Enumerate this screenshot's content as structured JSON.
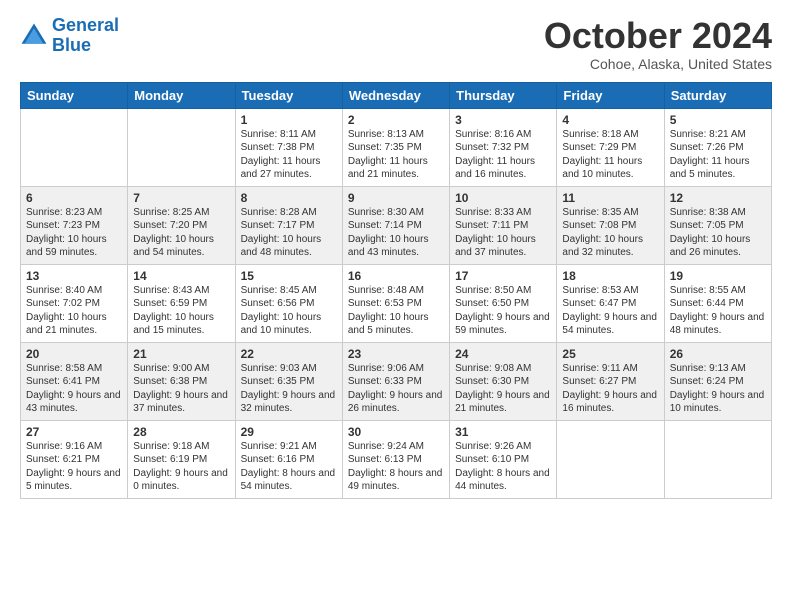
{
  "header": {
    "logo_line1": "General",
    "logo_line2": "Blue",
    "month": "October 2024",
    "location": "Cohoe, Alaska, United States"
  },
  "weekdays": [
    "Sunday",
    "Monday",
    "Tuesday",
    "Wednesday",
    "Thursday",
    "Friday",
    "Saturday"
  ],
  "weeks": [
    [
      {
        "day": "",
        "info": ""
      },
      {
        "day": "",
        "info": ""
      },
      {
        "day": "1",
        "info": "Sunrise: 8:11 AM\nSunset: 7:38 PM\nDaylight: 11 hours and 27 minutes."
      },
      {
        "day": "2",
        "info": "Sunrise: 8:13 AM\nSunset: 7:35 PM\nDaylight: 11 hours and 21 minutes."
      },
      {
        "day": "3",
        "info": "Sunrise: 8:16 AM\nSunset: 7:32 PM\nDaylight: 11 hours and 16 minutes."
      },
      {
        "day": "4",
        "info": "Sunrise: 8:18 AM\nSunset: 7:29 PM\nDaylight: 11 hours and 10 minutes."
      },
      {
        "day": "5",
        "info": "Sunrise: 8:21 AM\nSunset: 7:26 PM\nDaylight: 11 hours and 5 minutes."
      }
    ],
    [
      {
        "day": "6",
        "info": "Sunrise: 8:23 AM\nSunset: 7:23 PM\nDaylight: 10 hours and 59 minutes."
      },
      {
        "day": "7",
        "info": "Sunrise: 8:25 AM\nSunset: 7:20 PM\nDaylight: 10 hours and 54 minutes."
      },
      {
        "day": "8",
        "info": "Sunrise: 8:28 AM\nSunset: 7:17 PM\nDaylight: 10 hours and 48 minutes."
      },
      {
        "day": "9",
        "info": "Sunrise: 8:30 AM\nSunset: 7:14 PM\nDaylight: 10 hours and 43 minutes."
      },
      {
        "day": "10",
        "info": "Sunrise: 8:33 AM\nSunset: 7:11 PM\nDaylight: 10 hours and 37 minutes."
      },
      {
        "day": "11",
        "info": "Sunrise: 8:35 AM\nSunset: 7:08 PM\nDaylight: 10 hours and 32 minutes."
      },
      {
        "day": "12",
        "info": "Sunrise: 8:38 AM\nSunset: 7:05 PM\nDaylight: 10 hours and 26 minutes."
      }
    ],
    [
      {
        "day": "13",
        "info": "Sunrise: 8:40 AM\nSunset: 7:02 PM\nDaylight: 10 hours and 21 minutes."
      },
      {
        "day": "14",
        "info": "Sunrise: 8:43 AM\nSunset: 6:59 PM\nDaylight: 10 hours and 15 minutes."
      },
      {
        "day": "15",
        "info": "Sunrise: 8:45 AM\nSunset: 6:56 PM\nDaylight: 10 hours and 10 minutes."
      },
      {
        "day": "16",
        "info": "Sunrise: 8:48 AM\nSunset: 6:53 PM\nDaylight: 10 hours and 5 minutes."
      },
      {
        "day": "17",
        "info": "Sunrise: 8:50 AM\nSunset: 6:50 PM\nDaylight: 9 hours and 59 minutes."
      },
      {
        "day": "18",
        "info": "Sunrise: 8:53 AM\nSunset: 6:47 PM\nDaylight: 9 hours and 54 minutes."
      },
      {
        "day": "19",
        "info": "Sunrise: 8:55 AM\nSunset: 6:44 PM\nDaylight: 9 hours and 48 minutes."
      }
    ],
    [
      {
        "day": "20",
        "info": "Sunrise: 8:58 AM\nSunset: 6:41 PM\nDaylight: 9 hours and 43 minutes."
      },
      {
        "day": "21",
        "info": "Sunrise: 9:00 AM\nSunset: 6:38 PM\nDaylight: 9 hours and 37 minutes."
      },
      {
        "day": "22",
        "info": "Sunrise: 9:03 AM\nSunset: 6:35 PM\nDaylight: 9 hours and 32 minutes."
      },
      {
        "day": "23",
        "info": "Sunrise: 9:06 AM\nSunset: 6:33 PM\nDaylight: 9 hours and 26 minutes."
      },
      {
        "day": "24",
        "info": "Sunrise: 9:08 AM\nSunset: 6:30 PM\nDaylight: 9 hours and 21 minutes."
      },
      {
        "day": "25",
        "info": "Sunrise: 9:11 AM\nSunset: 6:27 PM\nDaylight: 9 hours and 16 minutes."
      },
      {
        "day": "26",
        "info": "Sunrise: 9:13 AM\nSunset: 6:24 PM\nDaylight: 9 hours and 10 minutes."
      }
    ],
    [
      {
        "day": "27",
        "info": "Sunrise: 9:16 AM\nSunset: 6:21 PM\nDaylight: 9 hours and 5 minutes."
      },
      {
        "day": "28",
        "info": "Sunrise: 9:18 AM\nSunset: 6:19 PM\nDaylight: 9 hours and 0 minutes."
      },
      {
        "day": "29",
        "info": "Sunrise: 9:21 AM\nSunset: 6:16 PM\nDaylight: 8 hours and 54 minutes."
      },
      {
        "day": "30",
        "info": "Sunrise: 9:24 AM\nSunset: 6:13 PM\nDaylight: 8 hours and 49 minutes."
      },
      {
        "day": "31",
        "info": "Sunrise: 9:26 AM\nSunset: 6:10 PM\nDaylight: 8 hours and 44 minutes."
      },
      {
        "day": "",
        "info": ""
      },
      {
        "day": "",
        "info": ""
      }
    ]
  ]
}
